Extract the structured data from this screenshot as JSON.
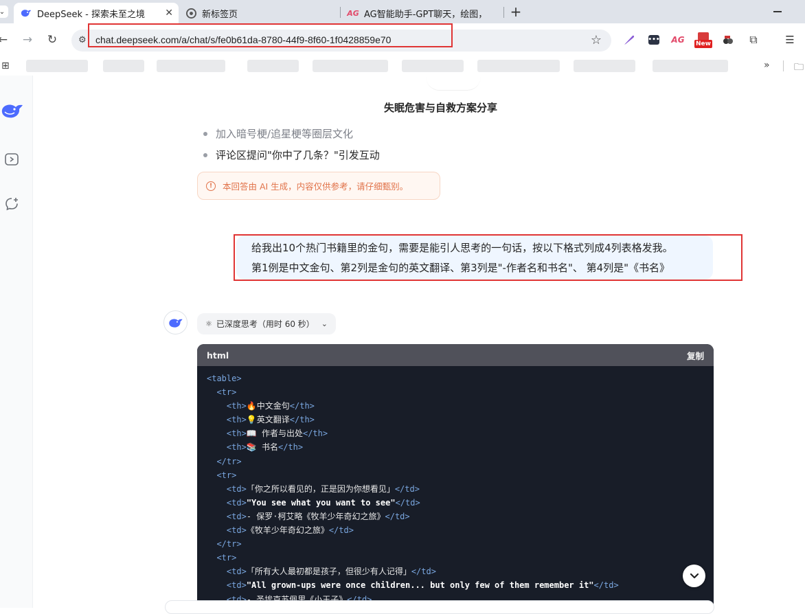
{
  "browser": {
    "tabs": [
      {
        "title": "DeepSeek - 探索未至之境",
        "active": true,
        "favicon": "deepseek-whale-icon"
      },
      {
        "title": "新标签页",
        "active": false,
        "favicon": "chrome-icon"
      },
      {
        "title": "AG智能助手-GPT聊天，绘图，",
        "active": false,
        "favicon": "ag-logo-icon"
      }
    ],
    "new_tab_label": "+",
    "url": "chat.deepseek.com/a/chat/s/fe0b61da-8780-44f9-8f60-1f0428859e70",
    "extension_badge": "New",
    "extension_ag_label": "AG"
  },
  "chat": {
    "title": "失眠危害与自救方案分享",
    "bullets": [
      "加入暗号梗/追星梗等圈层文化",
      "评论区提问\"你中了几条？\"引发互动"
    ],
    "disclaimer": "本回答由 AI 生成，内容仅供参考，请仔细甄别。",
    "user_message": {
      "line1": "给我出10个热门书籍里的金句，需要是能引人思考的一句话，按以下格式列成4列表格发我。",
      "line2": "第1例是中文金句、第2列是金句的英文翻译、第3列是\"-作者名和书名\"、 第4列是\"《书名》"
    },
    "thinking_label": "已深度思考（用时 60 秒）",
    "code": {
      "language": "html",
      "copy_label": "复制",
      "lines": [
        {
          "indent": "",
          "parts": [
            [
              "tg",
              "<table>"
            ]
          ]
        },
        {
          "indent": "  ",
          "parts": [
            [
              "tg",
              "<tr>"
            ]
          ]
        },
        {
          "indent": "    ",
          "parts": [
            [
              "tg",
              "<th>"
            ],
            [
              "tx",
              "🔥中文金句"
            ],
            [
              "tg",
              "</th>"
            ]
          ]
        },
        {
          "indent": "    ",
          "parts": [
            [
              "tg",
              "<th>"
            ],
            [
              "tx",
              "💡英文翻译"
            ],
            [
              "tg",
              "</th>"
            ]
          ]
        },
        {
          "indent": "    ",
          "parts": [
            [
              "tg",
              "<th>"
            ],
            [
              "tx",
              "📖 作者与出处"
            ],
            [
              "tg",
              "</th>"
            ]
          ]
        },
        {
          "indent": "    ",
          "parts": [
            [
              "tg",
              "<th>"
            ],
            [
              "tx",
              "📚 书名"
            ],
            [
              "tg",
              "</th>"
            ]
          ]
        },
        {
          "indent": "  ",
          "parts": [
            [
              "tg",
              "</tr>"
            ]
          ]
        },
        {
          "indent": "  ",
          "parts": [
            [
              "tg",
              "<tr>"
            ]
          ]
        },
        {
          "indent": "    ",
          "parts": [
            [
              "tg",
              "<td>"
            ],
            [
              "tx",
              "「你之所以看见的，正是因为你想看见」"
            ],
            [
              "tg",
              "</td>"
            ]
          ]
        },
        {
          "indent": "    ",
          "parts": [
            [
              "tg",
              "<td>"
            ],
            [
              "st",
              "\"You see what you want to see\""
            ],
            [
              "tg",
              "</td>"
            ]
          ]
        },
        {
          "indent": "    ",
          "parts": [
            [
              "tg",
              "<td>"
            ],
            [
              "tx",
              "- 保罗·柯艾略《牧羊少年奇幻之旅》"
            ],
            [
              "tg",
              "</td>"
            ]
          ]
        },
        {
          "indent": "    ",
          "parts": [
            [
              "tg",
              "<td>"
            ],
            [
              "tx",
              "《牧羊少年奇幻之旅》"
            ],
            [
              "tg",
              "</td>"
            ]
          ]
        },
        {
          "indent": "  ",
          "parts": [
            [
              "tg",
              "</tr>"
            ]
          ]
        },
        {
          "indent": "  ",
          "parts": [
            [
              "tg",
              "<tr>"
            ]
          ]
        },
        {
          "indent": "    ",
          "parts": [
            [
              "tg",
              "<td>"
            ],
            [
              "tx",
              "「所有大人最初都是孩子，但很少有人记得」"
            ],
            [
              "tg",
              "</td>"
            ]
          ]
        },
        {
          "indent": "    ",
          "parts": [
            [
              "tg",
              "<td>"
            ],
            [
              "st",
              "\"All grown-ups were once children... but only few of them remember it\""
            ],
            [
              "tg",
              "</td>"
            ]
          ]
        },
        {
          "indent": "    ",
          "parts": [
            [
              "tg",
              "<td>"
            ],
            [
              "tx",
              "- 圣埃克苏佩里《小王子》"
            ],
            [
              "tg",
              "</td>"
            ]
          ]
        }
      ]
    }
  },
  "colors": {
    "accent": "#4d6bfe",
    "highlight_box": "#e03434",
    "code_bg": "#181d28",
    "disclaimer_text": "#e1734a"
  }
}
